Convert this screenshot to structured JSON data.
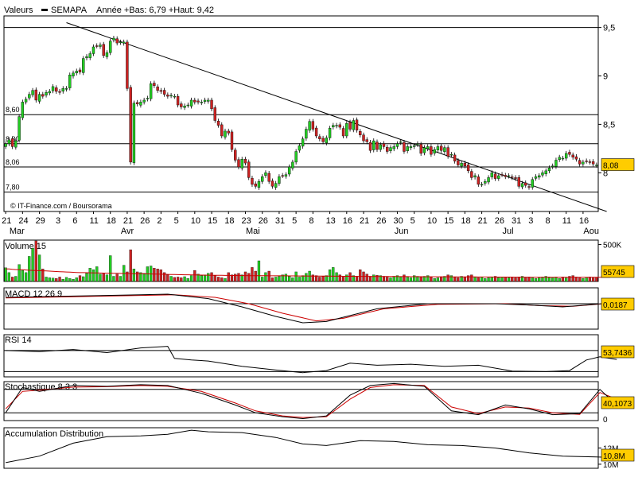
{
  "header": {
    "values_label": "Valeurs",
    "symbol": "SEMAPA",
    "period_info": "Année +Bas: 6,79 +Haut: 9,42"
  },
  "credit": "© IT-Finance.com / Boursorama",
  "colors": {
    "up": "#22cc22",
    "down": "#cc2222",
    "line": "#000000",
    "signal": "#cc0000",
    "value_badge": "#ffcc00",
    "grid": "#000000"
  },
  "chart_data": [
    {
      "type": "candlestick",
      "name": "price",
      "ylim": [
        7.6,
        9.62
      ],
      "yaxis_ticks": [
        "9,5",
        "9",
        "8,5",
        "8"
      ],
      "ytick_values": [
        9.5,
        9.0,
        8.5,
        8.0
      ],
      "horizontal_levels": [
        {
          "label": "8,60",
          "value": 8.6
        },
        {
          "label": "8,30",
          "value": 8.3
        },
        {
          "label": "8,06",
          "value": 8.06
        },
        {
          "label": "7,80",
          "value": 7.8
        }
      ],
      "last_value": "8,08",
      "xaxis_day_labels": [
        "21",
        "24",
        "29",
        "3",
        "6",
        "11",
        "18",
        "21",
        "26",
        "2",
        "5",
        "10",
        "15",
        "18",
        "23",
        "26",
        "31",
        "5",
        "8",
        "13",
        "16",
        "21",
        "26",
        "30",
        "5",
        "10",
        "15",
        "18",
        "21",
        "26",
        "31",
        "3",
        "8",
        "11",
        "16"
      ],
      "xaxis_month_labels": [
        "Mar",
        "Avr",
        "Mai",
        "Jun",
        "Jul",
        "Aou"
      ],
      "trendline": {
        "from": {
          "index": 18,
          "price": 9.55
        },
        "to": {
          "index": 178,
          "price": 7.6
        }
      },
      "closes": [
        8.3,
        8.34,
        8.27,
        8.33,
        8.58,
        8.73,
        8.76,
        8.81,
        8.85,
        8.75,
        8.81,
        8.79,
        8.83,
        8.84,
        8.89,
        8.84,
        8.83,
        8.87,
        8.87,
        9.01,
        9.03,
        9.05,
        9.04,
        9.18,
        9.2,
        9.23,
        9.3,
        9.31,
        9.32,
        9.21,
        9.24,
        9.36,
        9.39,
        9.34,
        9.35,
        9.35,
        8.87,
        8.11,
        8.72,
        8.71,
        8.73,
        8.75,
        8.77,
        8.92,
        8.9,
        8.85,
        8.84,
        8.81,
        8.79,
        8.8,
        8.79,
        8.7,
        8.68,
        8.69,
        8.7,
        8.75,
        8.73,
        8.73,
        8.73,
        8.75,
        8.75,
        8.66,
        8.54,
        8.49,
        8.38,
        8.43,
        8.41,
        8.24,
        8.13,
        8.06,
        8.14,
        8.1,
        7.95,
        7.88,
        7.86,
        7.91,
        7.96,
        8.0,
        7.91,
        7.86,
        7.89,
        7.96,
        7.97,
        7.98,
        8.06,
        8.11,
        8.22,
        8.28,
        8.35,
        8.45,
        8.53,
        8.45,
        8.38,
        8.35,
        8.32,
        8.36,
        8.46,
        8.49,
        8.49,
        8.47,
        8.38,
        8.51,
        8.45,
        8.54,
        8.44,
        8.39,
        8.33,
        8.32,
        8.23,
        8.33,
        8.24,
        8.29,
        8.27,
        8.22,
        8.26,
        8.27,
        8.3,
        8.32,
        8.22,
        8.27,
        8.27,
        8.28,
        8.3,
        8.2,
        8.26,
        8.27,
        8.19,
        8.24,
        8.27,
        8.23,
        8.26,
        8.17,
        8.19,
        8.12,
        8.08,
        8.1,
        8.07,
        8.02,
        7.95,
        7.97,
        7.88,
        7.88,
        7.91,
        7.95,
        8.0,
        7.94,
        7.97,
        7.98,
        7.96,
        7.97,
        7.95,
        7.94,
        7.86,
        7.89,
        7.87,
        7.85,
        7.93,
        7.96,
        7.97,
        8.0,
        8.02,
        8.05,
        8.07,
        8.13,
        8.16,
        8.15,
        8.2,
        8.19,
        8.16,
        8.14,
        8.09,
        8.11,
        8.12,
        8.11,
        8.09,
        8.08
      ],
      "volume": {
        "label": "Volume 15",
        "ytick": "500K",
        "max_label_value": 500000,
        "last_value": "55745",
        "values": [
          185000,
          120000,
          60000,
          70000,
          230000,
          150000,
          120000,
          340000,
          450000,
          550000,
          360000,
          170000,
          60000,
          50000,
          45000,
          40000,
          60000,
          30000,
          55000,
          40000,
          30000,
          50000,
          80000,
          65000,
          110000,
          180000,
          160000,
          200000,
          100000,
          110000,
          90000,
          350000,
          70000,
          100000,
          70000,
          220000,
          130000,
          430000,
          170000,
          130000,
          120000,
          110000,
          200000,
          210000,
          180000,
          170000,
          160000,
          120000,
          90000,
          70000,
          55000,
          60000,
          50000,
          65000,
          40000,
          80000,
          150000,
          100000,
          80000,
          90000,
          110000,
          120000,
          80000,
          60000,
          50000,
          40000,
          120000,
          90000,
          100000,
          110000,
          90000,
          130000,
          110000,
          190000,
          140000,
          280000,
          60000,
          120000,
          140000,
          50000,
          60000,
          70000,
          90000,
          100000,
          70000,
          50000,
          130000,
          60000,
          80000,
          110000,
          140000,
          90000,
          80000,
          60000,
          70000,
          80000,
          160000,
          190000,
          120000,
          90000,
          70000,
          90000,
          120000,
          80000,
          70000,
          160000,
          130000,
          100000,
          70000,
          90000,
          85000,
          80000,
          70000,
          60000,
          50000,
          70000,
          80000,
          60000,
          90000,
          60000,
          50000,
          80000,
          70000,
          60000,
          70000,
          80000,
          60000,
          40000,
          50000,
          60000,
          70000,
          90000,
          80000,
          60000,
          50000,
          70000,
          60000,
          80000,
          90000,
          60000,
          50000,
          60000,
          40000,
          50000,
          60000,
          70000,
          50000,
          60000,
          60000,
          50000,
          60000,
          50000,
          60000,
          70000,
          50000,
          60000,
          50000,
          40000,
          50000,
          60000,
          70000,
          60000,
          50000,
          60000,
          40000,
          60000,
          50000,
          70000,
          80000,
          60000,
          50000,
          40000,
          55000,
          60000,
          50000,
          55745
        ],
        "moving_average": [
          170000,
          170000,
          165000,
          160000,
          160000,
          158000,
          155000,
          152000,
          150000,
          148000,
          146000,
          144000,
          142000,
          140000,
          138000,
          135000,
          132000,
          130000,
          128000,
          126000,
          124000,
          122000,
          120000,
          120000,
          118000,
          117000,
          116000,
          115000,
          114000,
          113000,
          112000,
          112000,
          111000,
          110000,
          109000,
          108000,
          108000,
          107000,
          106000,
          105000,
          104000,
          103000,
          102000,
          101000,
          100000,
          99000,
          98000,
          97000,
          96000,
          95000,
          94000,
          93000,
          92000,
          91000,
          90000,
          89000,
          88000,
          87000,
          86000,
          85000,
          85000,
          84000,
          84000,
          83000,
          83000,
          82000,
          82000,
          81000,
          81000,
          80000,
          80000,
          80000,
          79000,
          79000,
          79000,
          78000,
          78000,
          78000,
          77000,
          77000,
          77000,
          76000,
          76000,
          76000,
          75000,
          75000,
          75000,
          74000,
          74000,
          74000,
          73000,
          73000,
          73000,
          72000,
          72000,
          72000,
          72000,
          71000,
          71000,
          71000,
          70000,
          70000,
          70000,
          70000,
          69000,
          69000,
          69000,
          69000,
          68000,
          68000,
          68000,
          68000,
          67000,
          67000,
          67000,
          67000,
          66000,
          66000,
          66000,
          66000,
          65000,
          65000,
          65000,
          65000,
          64000,
          64000,
          64000,
          64000,
          63000,
          63000,
          63000,
          63000,
          62000,
          62000,
          62000,
          62000,
          61000,
          61000,
          61000,
          61000,
          60000,
          60000,
          60000,
          60000,
          60000,
          59000,
          59000,
          59000,
          59000,
          59000,
          58000,
          58000,
          58000,
          58000,
          58000,
          57000,
          57000,
          57000,
          57000,
          57000,
          57000,
          56000,
          56000,
          56000,
          56000,
          56000,
          56000,
          56000,
          56000,
          56000,
          56000,
          56000,
          56000,
          56000,
          56000,
          56000,
          56000,
          56000,
          56000,
          56000
        ]
      }
    },
    {
      "type": "line",
      "name": "macd",
      "label": "MACD 12 26 9",
      "last_value": "0,0187",
      "ylim": [
        -0.4,
        0.25
      ],
      "zero_level": 0,
      "macd_points": [
        [
          0,
          0.1
        ],
        [
          20,
          0.12
        ],
        [
          40,
          0.14
        ],
        [
          48,
          0.15
        ],
        [
          60,
          0.08
        ],
        [
          70,
          -0.05
        ],
        [
          80,
          -0.2
        ],
        [
          88,
          -0.3
        ],
        [
          95,
          -0.28
        ],
        [
          110,
          -0.08
        ],
        [
          125,
          0.0
        ],
        [
          145,
          0.0
        ],
        [
          155,
          -0.02
        ],
        [
          165,
          -0.05
        ],
        [
          172,
          -0.02
        ],
        [
          181,
          0.02
        ]
      ],
      "signal_points": [
        [
          0,
          0.09
        ],
        [
          20,
          0.11
        ],
        [
          40,
          0.13
        ],
        [
          50,
          0.14
        ],
        [
          62,
          0.1
        ],
        [
          72,
          0.0
        ],
        [
          82,
          -0.15
        ],
        [
          92,
          -0.27
        ],
        [
          100,
          -0.23
        ],
        [
          112,
          -0.08
        ],
        [
          128,
          -0.01
        ],
        [
          148,
          0.0
        ],
        [
          158,
          -0.03
        ],
        [
          168,
          -0.04
        ],
        [
          175,
          -0.01
        ],
        [
          181,
          0.02
        ]
      ]
    },
    {
      "type": "line",
      "name": "rsi",
      "label": "RSI 14",
      "last_value": "53,7436",
      "ylim": [
        20,
        100
      ],
      "levels": [
        70,
        30
      ],
      "points": [
        [
          0,
          70
        ],
        [
          10,
          68
        ],
        [
          20,
          72
        ],
        [
          30,
          66
        ],
        [
          40,
          75
        ],
        [
          48,
          78
        ],
        [
          50,
          55
        ],
        [
          55,
          52
        ],
        [
          60,
          50
        ],
        [
          70,
          40
        ],
        [
          80,
          33
        ],
        [
          88,
          28
        ],
        [
          95,
          32
        ],
        [
          102,
          46
        ],
        [
          110,
          42
        ],
        [
          120,
          44
        ],
        [
          130,
          40
        ],
        [
          140,
          42
        ],
        [
          150,
          31
        ],
        [
          160,
          30
        ],
        [
          167,
          32
        ],
        [
          172,
          52
        ],
        [
          176,
          58
        ],
        [
          181,
          53
        ]
      ]
    },
    {
      "type": "line",
      "name": "stochastic",
      "label": "Stochastique 8 3 3",
      "last_value": "40,1073",
      "ylim": [
        0,
        100
      ],
      "ytick": "0",
      "levels": [
        80,
        20
      ],
      "k_points": [
        [
          0,
          20
        ],
        [
          5,
          85
        ],
        [
          10,
          75
        ],
        [
          20,
          90
        ],
        [
          30,
          88
        ],
        [
          40,
          92
        ],
        [
          48,
          90
        ],
        [
          58,
          70
        ],
        [
          68,
          40
        ],
        [
          74,
          20
        ],
        [
          82,
          10
        ],
        [
          88,
          5
        ],
        [
          95,
          12
        ],
        [
          102,
          65
        ],
        [
          108,
          90
        ],
        [
          115,
          95
        ],
        [
          124,
          88
        ],
        [
          132,
          25
        ],
        [
          140,
          15
        ],
        [
          148,
          40
        ],
        [
          155,
          30
        ],
        [
          162,
          15
        ],
        [
          170,
          18
        ],
        [
          176,
          80
        ],
        [
          181,
          40
        ]
      ],
      "d_points": [
        [
          0,
          30
        ],
        [
          5,
          75
        ],
        [
          10,
          78
        ],
        [
          20,
          86
        ],
        [
          30,
          87
        ],
        [
          40,
          90
        ],
        [
          48,
          88
        ],
        [
          58,
          75
        ],
        [
          68,
          45
        ],
        [
          74,
          25
        ],
        [
          82,
          12
        ],
        [
          88,
          8
        ],
        [
          95,
          10
        ],
        [
          102,
          55
        ],
        [
          108,
          85
        ],
        [
          115,
          92
        ],
        [
          124,
          90
        ],
        [
          132,
          35
        ],
        [
          140,
          18
        ],
        [
          148,
          35
        ],
        [
          155,
          32
        ],
        [
          162,
          20
        ],
        [
          170,
          16
        ],
        [
          176,
          72
        ],
        [
          181,
          55
        ]
      ]
    },
    {
      "type": "line",
      "name": "accumulation",
      "label": "Accumulation Distribution",
      "last_value": "10,8M",
      "ylim": [
        9.5,
        14.5
      ],
      "yaxis_ticks": [
        "12M",
        "10M"
      ],
      "ytick_values": [
        12,
        10
      ],
      "points": [
        [
          0,
          10.2
        ],
        [
          10,
          11.0
        ],
        [
          20,
          12.6
        ],
        [
          30,
          13.4
        ],
        [
          40,
          13.5
        ],
        [
          48,
          13.7
        ],
        [
          55,
          14.2
        ],
        [
          60,
          14.0
        ],
        [
          70,
          13.9
        ],
        [
          80,
          13.3
        ],
        [
          88,
          12.5
        ],
        [
          95,
          12.3
        ],
        [
          105,
          12.9
        ],
        [
          115,
          12.8
        ],
        [
          125,
          12.4
        ],
        [
          135,
          12.3
        ],
        [
          145,
          12.0
        ],
        [
          155,
          11.4
        ],
        [
          165,
          11.0
        ],
        [
          175,
          10.9
        ],
        [
          181,
          10.8
        ]
      ]
    }
  ]
}
